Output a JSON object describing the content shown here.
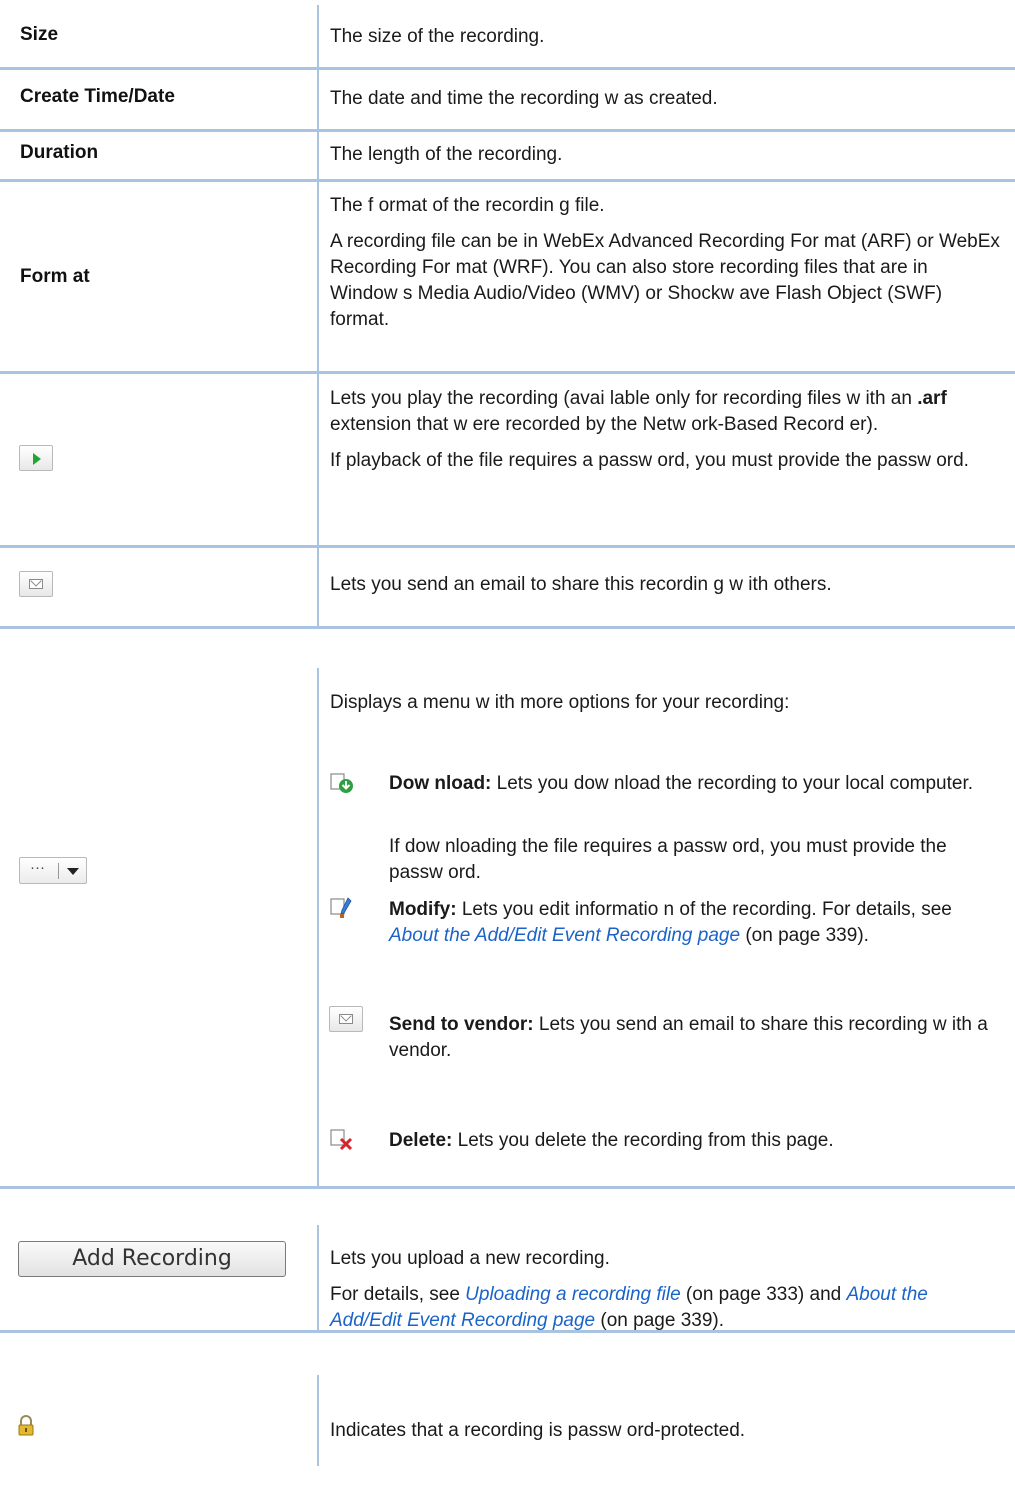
{
  "rows": {
    "size": {
      "label": "Size",
      "desc": "The size of the recording."
    },
    "create": {
      "label": "Create Time/Date",
      "desc": "The date and time the recording w as created."
    },
    "duration": {
      "label": "Duration",
      "desc": "The length of the recording."
    },
    "format": {
      "label": "Form at",
      "desc1": "The f ormat of the recordin g file.",
      "desc2": "A recording file can be in WebEx Advanced Recording For mat (ARF) or WebEx Recording For mat (WRF). You can also store recording files that are in Window s Media Audio/Video (WMV) or Shockw ave Flash Object (SWF) format."
    },
    "play": {
      "icon": "play-icon",
      "desc1_a": "Lets you play the recording (avai lable only for recording files w ith an ",
      "desc1_b": ".arf",
      "desc1_c": " extension that w ere recorded by the Netw ork-Based Record er).",
      "desc2": "If playback of the file requires a passw ord, you must provide the passw ord."
    },
    "email": {
      "icon": "envelope-icon",
      "desc": "Lets you send an email to share this recordin g w ith others."
    },
    "more": {
      "intro": "Displays a menu w ith more options for your recording:",
      "download": {
        "title": "Dow nload:",
        "text": " Lets you dow nload the recording to your local computer.",
        "note": "If dow nloading the file requires a passw ord, you must provide the passw ord."
      },
      "modify": {
        "title": "Modify:",
        "text": " Lets you edit informatio n of the recording. For details, see ",
        "link": "About the Add/Edit Event Recording page",
        "after": " (on page 339)."
      },
      "vendor": {
        "title": "Send to vendor:",
        "text": " Lets you send an email to share this recording w ith a vendor."
      },
      "delete": {
        "title": "Delete:",
        "text": " Lets you delete the recording from this page."
      }
    },
    "add": {
      "button": "Add Recording",
      "desc1": "Lets you upload a new recording.",
      "desc2_a": "For details, see ",
      "link1": "Uploading a recording file",
      "desc2_b": " (on page 333) and ",
      "link2": "About the Add/Edit Event Recording page",
      "desc2_c": " (on page 339)."
    },
    "lock": {
      "icon": "lock-icon",
      "desc": "Indicates that a recording is passw ord-protected."
    }
  }
}
